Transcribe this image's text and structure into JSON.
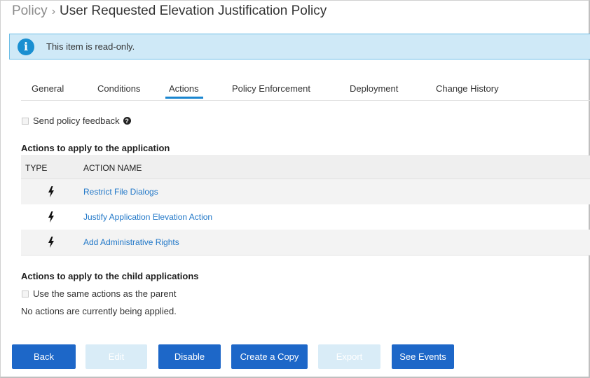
{
  "breadcrumb": {
    "root": "Policy",
    "separator": "›",
    "title": "User Requested Elevation Justification Policy"
  },
  "banner": {
    "icon": "info-icon",
    "text": "This item is read-only."
  },
  "tabs": [
    {
      "label": "General",
      "active": false
    },
    {
      "label": "Conditions",
      "active": false
    },
    {
      "label": "Actions",
      "active": true
    },
    {
      "label": "Policy Enforcement",
      "active": false
    },
    {
      "label": "Deployment",
      "active": false
    },
    {
      "label": "Change History",
      "active": false
    }
  ],
  "feedback": {
    "label": "Send policy feedback",
    "checked": false,
    "help_icon": "question-circle-icon"
  },
  "app_actions": {
    "heading": "Actions to apply to the application",
    "columns": [
      "TYPE",
      "ACTION NAME"
    ],
    "rows": [
      {
        "type_icon": "lightning-bolt-icon",
        "name": "Restrict File Dialogs"
      },
      {
        "type_icon": "lightning-bolt-icon",
        "name": "Justify Application Elevation Action"
      },
      {
        "type_icon": "lightning-bolt-icon",
        "name": "Add Administrative Rights"
      }
    ]
  },
  "child_actions": {
    "heading": "Actions to apply to the child applications",
    "same_as_parent_label": "Use the same actions as the parent",
    "same_as_parent_checked": false,
    "empty_text": "No actions are currently being applied."
  },
  "buttons": {
    "back": "Back",
    "edit": "Edit",
    "disable": "Disable",
    "create_copy": "Create a Copy",
    "export": "Export",
    "see_events": "See Events"
  },
  "colors": {
    "primary_button": "#1d67c8",
    "disabled_button": "#d9ecf7",
    "link": "#2278c8",
    "banner_background": "#cfe9f7",
    "banner_border": "#6cbde6",
    "tab_underline": "#1a86d0"
  }
}
